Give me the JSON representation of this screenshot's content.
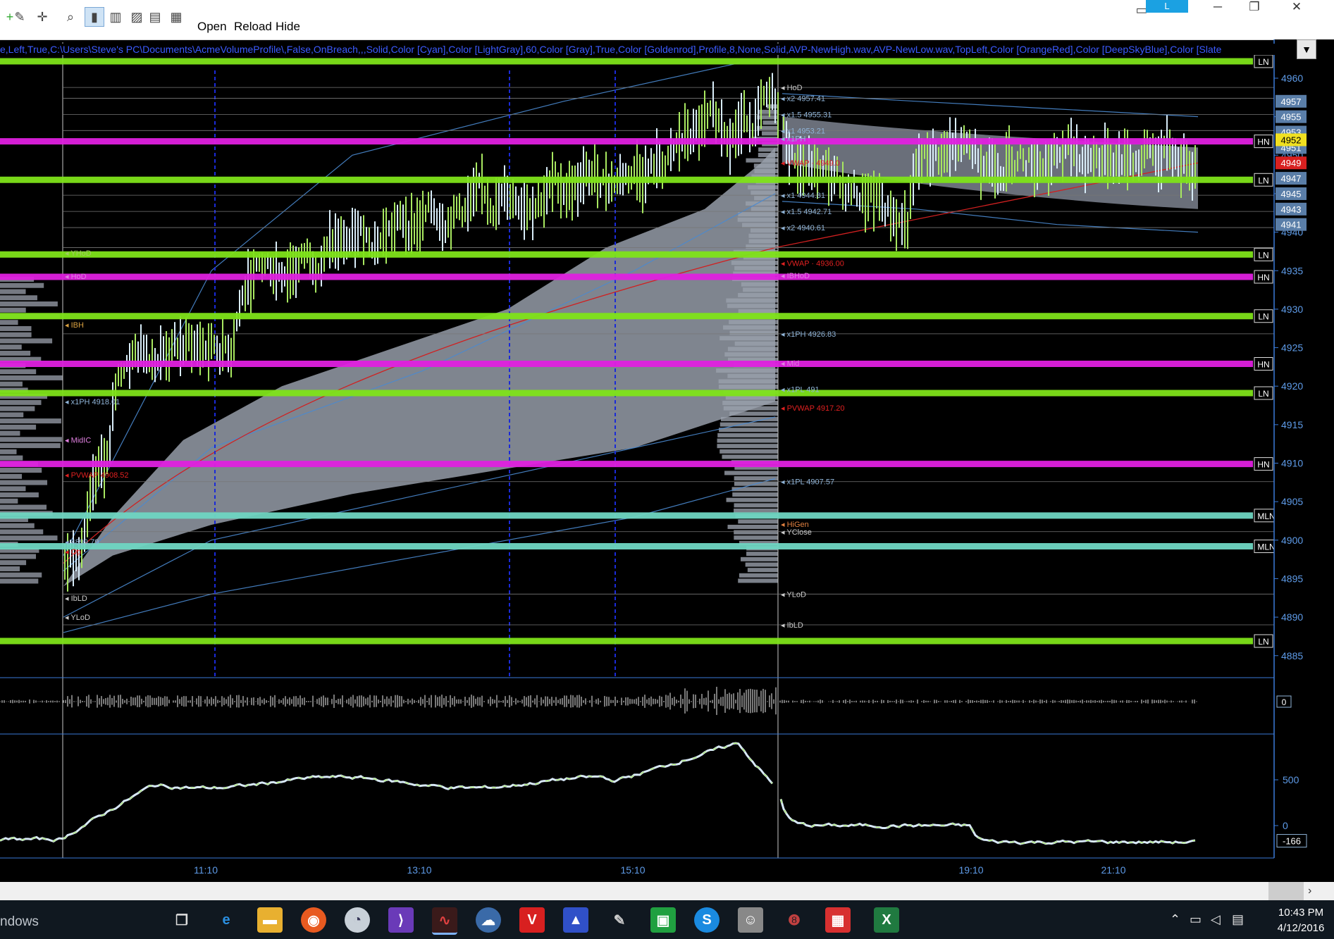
{
  "window": {
    "toolbar_buttons": [
      "Open",
      "Reload",
      "Hide"
    ],
    "tab_label": "L",
    "minimize_glyph": "─",
    "restore_glyph": "❐",
    "close_glyph": "✕"
  },
  "settings_strip": {
    "text": "e,Left,True,C:\\Users\\Steve's PC\\Documents\\AcmeVolumeProfile\\,False,OnBreach,,,Solid,Color [Cyan],Color [LightGray],60,Color [Gray],True,Color [Goldenrod],Profile,8,None,Solid,AVP-NewHigh.wav,AVP-NewLow.wav,TopLeft,Color [OrangeRed],Color [DeepSkyBlue],Color [Slate",
    "dropdown_glyph": "▼"
  },
  "colors": {
    "background": "#000000",
    "level_green": "#7fe31a",
    "level_magenta": "#e020e0",
    "level_teal": "#6fd6c2",
    "candle_up": "#a8e860",
    "candle_down": "#d8ecf8",
    "profile_fill": "#8f96a4",
    "axis_blue": "#3a7ad8",
    "vwap_red": "#d02020"
  },
  "price_axis": {
    "ticks": [
      "4960",
      "4955",
      "4950",
      "4945",
      "4940",
      "4935",
      "4930",
      "4925",
      "4920",
      "4915",
      "4910",
      "4905",
      "4900",
      "4895",
      "4890",
      "4885"
    ],
    "current_price": "4952",
    "vwap_badge": "4949",
    "level_badges": [
      "4957",
      "4955",
      "4953",
      "4951",
      "4947",
      "4945",
      "4943",
      "4941"
    ]
  },
  "level_lines": [
    {
      "type": "green",
      "label": "LN",
      "price": 4962.2
    },
    {
      "type": "magenta",
      "label": "HN",
      "price": 4951.8
    },
    {
      "type": "green",
      "label": "LN",
      "price": 4946.8
    },
    {
      "type": "green",
      "label": "LN",
      "price": 4937.1
    },
    {
      "type": "magenta",
      "label": "HN",
      "price": 4934.2
    },
    {
      "type": "green",
      "label": "LN",
      "price": 4929.1
    },
    {
      "type": "magenta",
      "label": "HN",
      "price": 4922.9
    },
    {
      "type": "green",
      "label": "LN",
      "price": 4919.1
    },
    {
      "type": "magenta",
      "label": "HN",
      "price": 4909.9
    },
    {
      "type": "teal",
      "label": "MLN",
      "price": 4903.2
    },
    {
      "type": "teal",
      "label": "MLN",
      "price": 4899.2
    },
    {
      "type": "green",
      "label": "LN",
      "price": 4886.9
    }
  ],
  "annotations": [
    {
      "text": "HoD",
      "color": "#cccccc",
      "price": 4958.8
    },
    {
      "text": "x2  4957.41",
      "color": "#8fb4d8",
      "price": 4957.4
    },
    {
      "text": "x1.5  4955.31",
      "color": "#8fb4d8",
      "price": 4955.3
    },
    {
      "text": "x1  4953.21",
      "color": "#8fb4d8",
      "price": 4953.2
    },
    {
      "text": "x1PH",
      "color": "#8fb4d8",
      "price": 4952.2
    },
    {
      "text": "VWAP · 4949.0",
      "color": "#e02020",
      "price": 4949.0
    },
    {
      "text": "x1  4944.81",
      "color": "#8fb4d8",
      "price": 4944.8
    },
    {
      "text": "x1.5  4942.71",
      "color": "#8fb4d8",
      "price": 4942.7
    },
    {
      "text": "x2  4940.61",
      "color": "#8fb4d8",
      "price": 4940.6
    },
    {
      "text": "VWAP · 4936.00",
      "color": "#e02020",
      "price": 4936.0
    },
    {
      "text": "IBHoD",
      "color": "#e080e0",
      "price": 4934.4
    },
    {
      "text": "x1PH 4926.83",
      "color": "#8fb4d8",
      "price": 4926.8
    },
    {
      "text": "Mid",
      "color": "#e080e0",
      "price": 4923.0
    },
    {
      "text": "x1PL 491",
      "color": "#8fb4d8",
      "price": 4919.6
    },
    {
      "text": "PVWAP 4917.20",
      "color": "#e02020",
      "price": 4917.2
    },
    {
      "text": "x1PL 4907.57",
      "color": "#8fb4d8",
      "price": 4907.6
    },
    {
      "text": "HiGen",
      "color": "#e08040",
      "price": 4902.1
    },
    {
      "text": "YClose",
      "color": "#cccccc",
      "price": 4901.1
    },
    {
      "text": "YLoD",
      "color": "#cccccc",
      "price": 4893.0
    },
    {
      "text": "IbLD",
      "color": "#cccccc",
      "price": 4889.0
    }
  ],
  "left_annotations": [
    {
      "text": "YHoD",
      "color": "#9fcc60",
      "price": 4937.3
    },
    {
      "text": "HoD",
      "color": "#e080e0",
      "price": 4934.3
    },
    {
      "text": "IBH",
      "color": "#d8a040",
      "price": 4928.0
    },
    {
      "text": "x1PH 4918.01",
      "color": "#8fb4d8",
      "price": 4918.0
    },
    {
      "text": "MidIC",
      "color": "#e080e0",
      "price": 4913.0
    },
    {
      "text": "PVWAP 4908.52",
      "color": "#e02020",
      "price": 4908.5
    },
    {
      "text": "4899.79",
      "color": "#8fb4d8",
      "price": 4899.8
    },
    {
      "text": "Op",
      "color": "#e02020",
      "price": 4898.5
    },
    {
      "text": "IbLD",
      "color": "#cccccc",
      "price": 4892.5
    },
    {
      "text": "YLoD",
      "color": "#cccccc",
      "price": 4890.0
    }
  ],
  "volume_panel": {
    "axis_label": "0"
  },
  "cumdelta_panel": {
    "ticks": [
      "500",
      "0"
    ],
    "current_value": "-166"
  },
  "time_axis": {
    "labels": [
      "11:10",
      "13:10",
      "15:10",
      "19:10",
      "21:10"
    ]
  },
  "taskbar": {
    "start_text": "ndows",
    "apps": [
      "task-view",
      "edge",
      "file-explorer",
      "firefox",
      "chrome",
      "visual-studio",
      "ninjatrader",
      "cloud",
      "vivaldi",
      "affinity",
      "paint",
      "skype",
      "photo",
      "excel"
    ],
    "time": "10:43 PM",
    "date": "4/12/2016"
  }
}
